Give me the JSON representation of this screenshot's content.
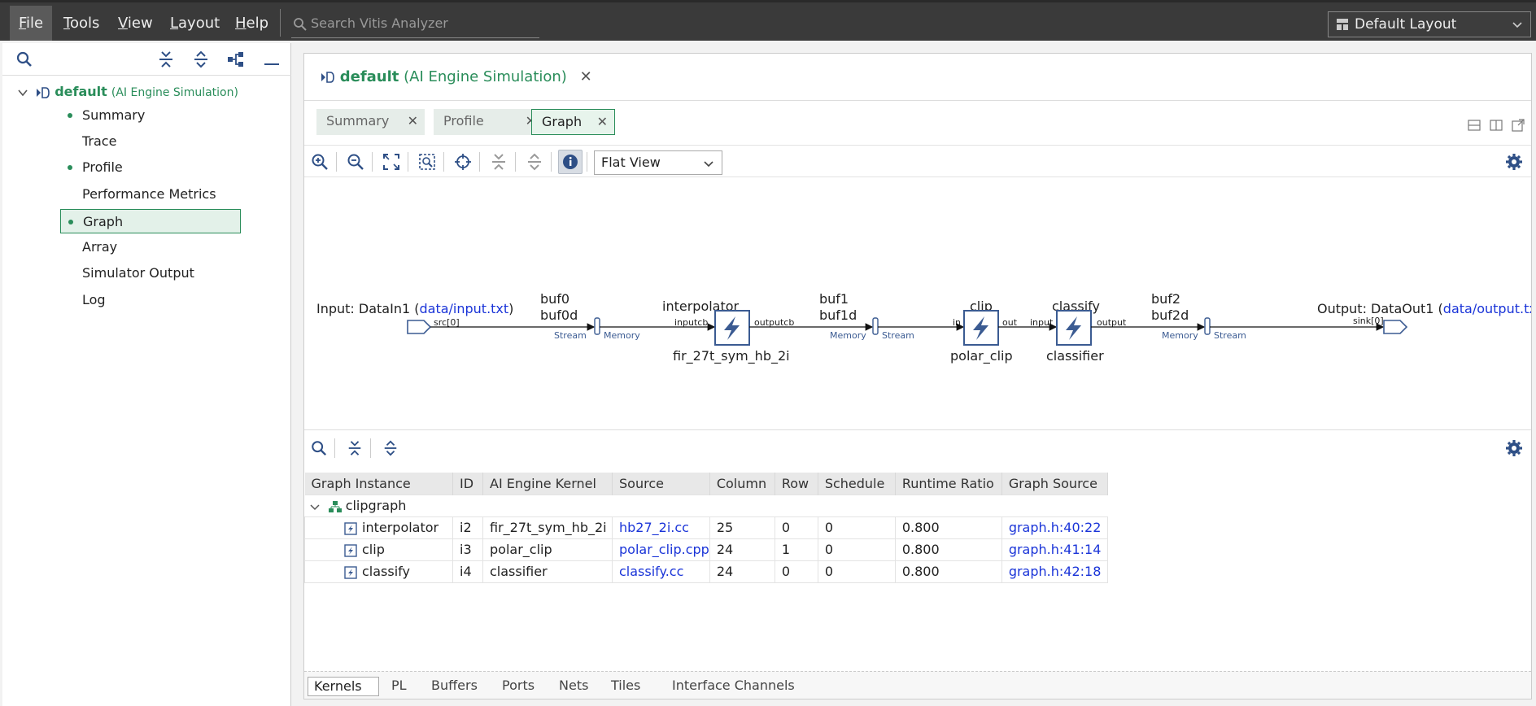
{
  "menu": {
    "items": [
      {
        "label": "File",
        "accel": "F"
      },
      {
        "label": "Tools",
        "accel": "T"
      },
      {
        "label": "View",
        "accel": "V"
      },
      {
        "label": "Layout",
        "accel": "L"
      },
      {
        "label": "Help",
        "accel": "H"
      }
    ],
    "search_placeholder": "Search Vitis Analyzer",
    "layout_select": "Default Layout"
  },
  "navigator": {
    "root_name": "default",
    "root_sub": "(AI Engine Simulation)",
    "items": [
      {
        "label": "Summary",
        "dot": true
      },
      {
        "label": "Trace",
        "dot": false
      },
      {
        "label": "Profile",
        "dot": true
      },
      {
        "label": "Performance Metrics",
        "dot": false
      },
      {
        "label": "Graph",
        "dot": true,
        "selected": true
      },
      {
        "label": "Array",
        "dot": false
      },
      {
        "label": "Simulator Output",
        "dot": false
      },
      {
        "label": "Log",
        "dot": false
      }
    ]
  },
  "editor": {
    "title_name": "default",
    "title_sub": "(AI Engine Simulation)",
    "close": "✕",
    "tabs": [
      {
        "label": "Summary"
      },
      {
        "label": "Profile"
      },
      {
        "label": "Graph",
        "active": true
      }
    ],
    "tab_close": "✕",
    "view_select": "Flat View"
  },
  "graph": {
    "input_label": "Input: DataIn1 (",
    "input_link": "data/input.txt",
    "input_close": ")",
    "input_port": "src[0]",
    "output_label": "Output: DataOut1 (",
    "output_link": "data/output.txt",
    "output_close": ")",
    "output_port": "sink[0]",
    "buffers": [
      {
        "name": "buf0",
        "name2": "buf0d",
        "left_label": "Stream",
        "right_label": "Memory"
      },
      {
        "name": "buf1",
        "name2": "buf1d",
        "left_label": "Memory",
        "right_label": "Stream"
      },
      {
        "name": "buf2",
        "name2": "buf2d",
        "left_label": "Memory",
        "right_label": "Stream"
      }
    ],
    "kernels": [
      {
        "name": "interpolator",
        "func": "fir_27t_sym_hb_2i",
        "in_port": "inputcb",
        "out_port": "outputcb"
      },
      {
        "name": "clip",
        "func": "polar_clip",
        "in_port": "in",
        "out_port": "out"
      },
      {
        "name": "classify",
        "func": "classifier",
        "in_port": "input",
        "out_port": "output"
      }
    ]
  },
  "table": {
    "headers": [
      "Graph Instance",
      "ID",
      "AI Engine Kernel",
      "Source",
      "Column",
      "Row",
      "Schedule",
      "Runtime Ratio",
      "Graph Source"
    ],
    "group": "clipgraph",
    "rows": [
      [
        "interpolator",
        "i2",
        "fir_27t_sym_hb_2i",
        "hb27_2i.cc",
        "25",
        "0",
        "0",
        "0.800",
        "graph.h:40:22"
      ],
      [
        "clip",
        "i3",
        "polar_clip",
        "polar_clip.cpp",
        "24",
        "1",
        "0",
        "0.800",
        "graph.h:41:14"
      ],
      [
        "classify",
        "i4",
        "classifier",
        "classify.cc",
        "24",
        "0",
        "0",
        "0.800",
        "graph.h:42:18"
      ]
    ]
  },
  "bottom_tabs": [
    "Kernels",
    "PL",
    "Buffers",
    "Ports",
    "Nets",
    "Tiles",
    "Interface Channels"
  ],
  "colors": {
    "accent_green": "#2a8d5a",
    "link_blue": "#1a34d8",
    "kernel_blue": "#3b5b92"
  }
}
